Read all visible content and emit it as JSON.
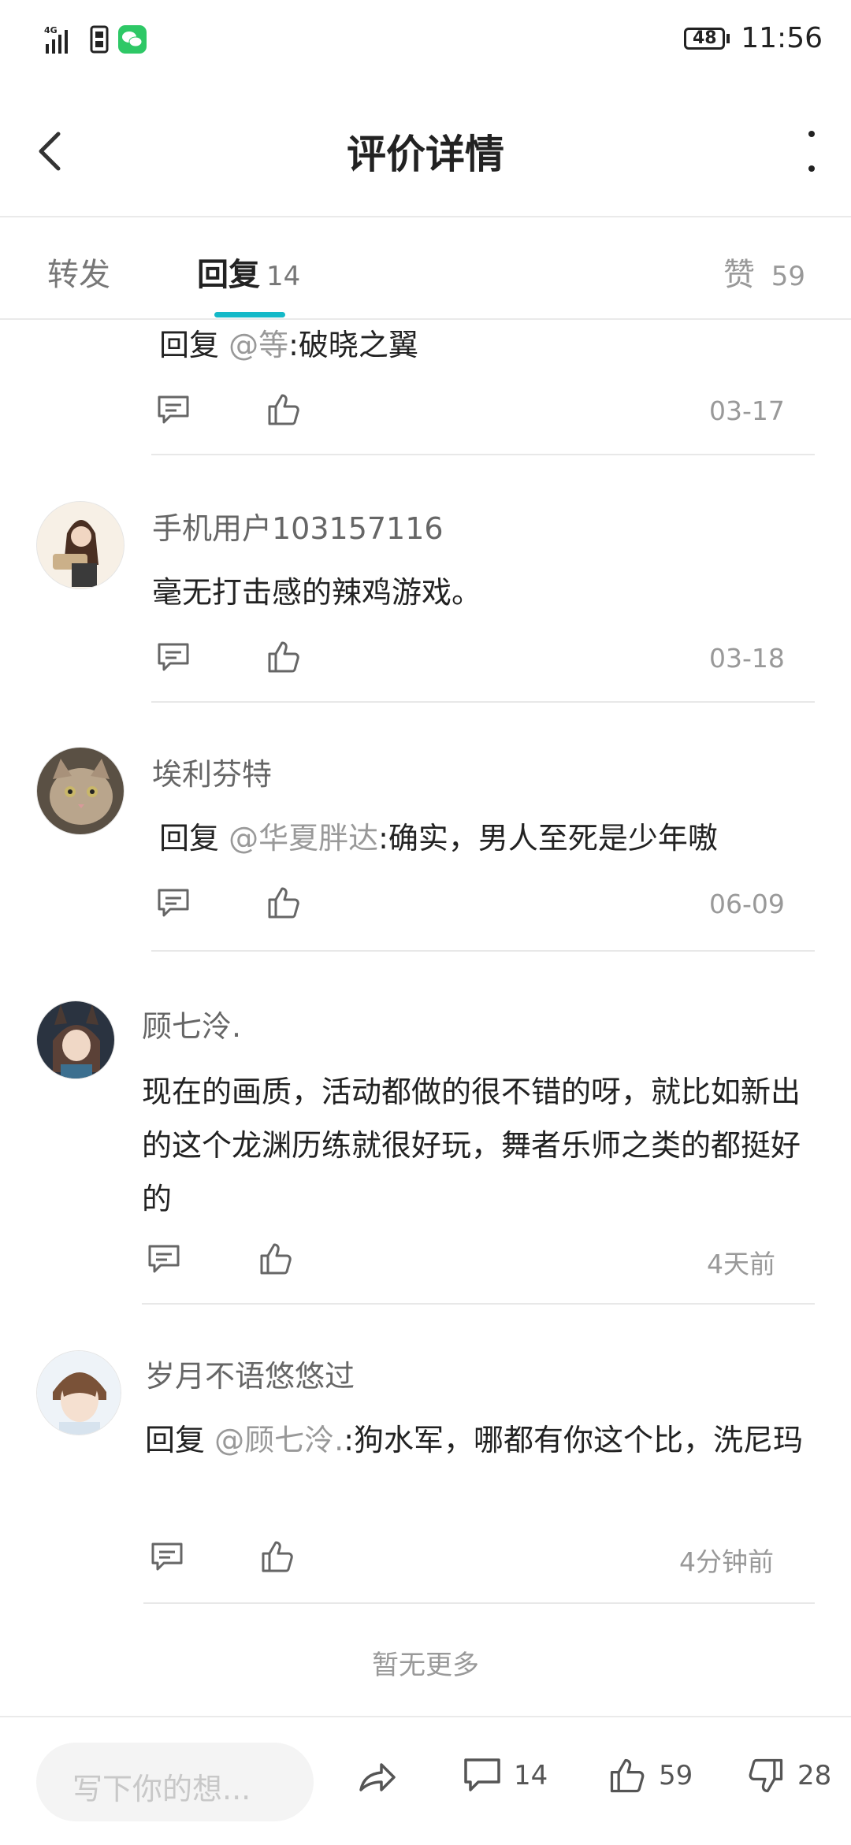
{
  "status_bar": {
    "network": "4G",
    "battery": "48",
    "time": "11:56"
  },
  "header": {
    "title": "评价详情"
  },
  "tabs": {
    "forward": "转发",
    "reply": "回复",
    "reply_count": "14",
    "likes_label": "赞",
    "likes_count": "59"
  },
  "comments": [
    {
      "username": "",
      "reply_prefix": "回复 ",
      "mention": "@等",
      "text": ":破晓之翼",
      "date": "03-17"
    },
    {
      "username": "手机用户103157116",
      "reply_prefix": "",
      "mention": "",
      "text": "毫无打击感的辣鸡游戏。",
      "date": "03-18"
    },
    {
      "username": "埃利芬特",
      "reply_prefix": "回复 ",
      "mention": "@华夏胖达",
      "text": ":确实，男人至死是少年嗷",
      "date": "06-09"
    },
    {
      "username": "顾七泠.",
      "reply_prefix": "",
      "mention": "",
      "text": "现在的画质，活动都做的很不错的呀，就比如新出的这个龙渊历练就很好玩，舞者乐师之类的都挺好的",
      "date": "4天前"
    },
    {
      "username": "岁月不语悠悠过",
      "reply_prefix": "回复 ",
      "mention": "@顾七泠.",
      "text": ":狗水军，哪都有你这个比，洗尼玛",
      "date": "4分钟前"
    }
  ],
  "footer": {
    "no_more": "暂无更多"
  },
  "bottom_bar": {
    "input_placeholder": "写下你的想...",
    "comment_count": "14",
    "like_count": "59",
    "dislike_count": "28"
  },
  "colors": {
    "accent": "#14b9c8",
    "mention": "#999999"
  }
}
